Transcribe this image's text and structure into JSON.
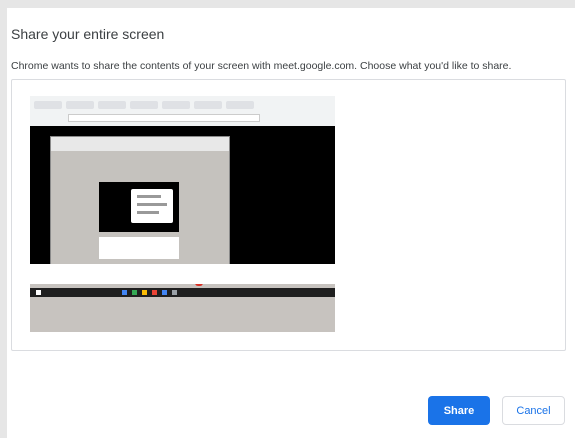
{
  "dialog": {
    "title": "Share your entire screen",
    "subtitle": "Chrome wants to share the contents of your screen with meet.google.com. Choose what you'd like to share.",
    "source_thumbnail_icon": "screen-preview-icon"
  },
  "actions": {
    "share_label": "Share",
    "cancel_label": "Cancel"
  },
  "colors": {
    "accent": "#1a73e8",
    "text": "#3c4043",
    "border": "#dadce0"
  }
}
